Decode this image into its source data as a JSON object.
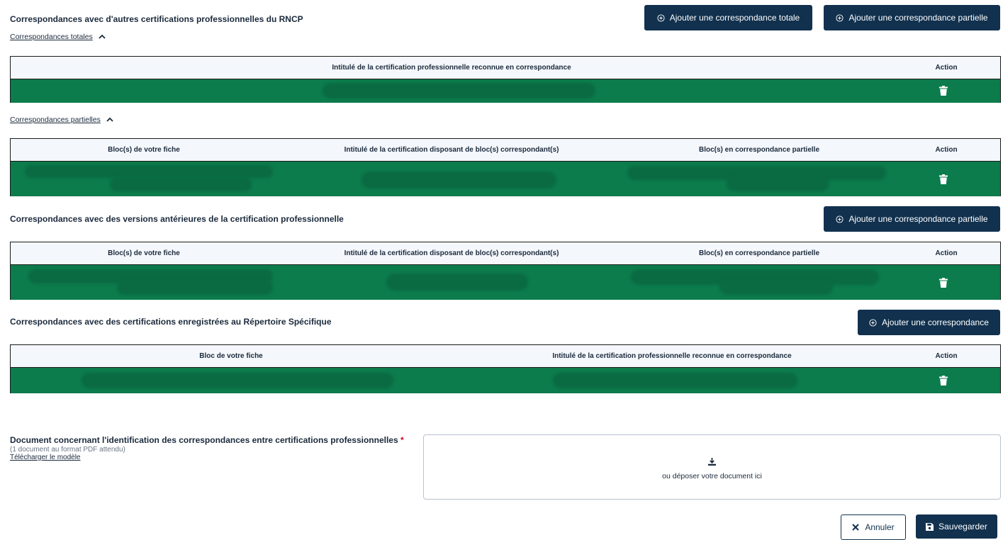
{
  "rncp": {
    "title": "Correspondances avec d'autres certifications professionnelles du RNCP",
    "btn_totale": "Ajouter une correspondance totale",
    "btn_partielle": "Ajouter une correspondance partielle",
    "totales_link": "Correspondances totales",
    "totales_headers": [
      "Intitulé de la certification professionnelle reconnue en correspondance",
      "Action"
    ],
    "partielles_link": "Correspondances partielles",
    "partielles_headers": [
      "Bloc(s) de votre fiche",
      "Intitulé de la certification disposant de bloc(s) correspondant(s)",
      "Bloc(s) en correspondance partielle",
      "Action"
    ]
  },
  "anterieures": {
    "title": "Correspondances avec des versions antérieures de la certification professionnelle",
    "btn_partielle": "Ajouter une correspondance partielle",
    "headers": [
      "Bloc(s) de votre fiche",
      "Intitulé de la certification disposant de bloc(s) correspondant(s)",
      "Bloc(s) en correspondance partielle",
      "Action"
    ]
  },
  "rs": {
    "title": "Correspondances avec des certifications enregistrées au Répertoire Spécifique",
    "btn": "Ajouter une correspondance",
    "headers": [
      "Bloc de votre fiche",
      "Intitulé de la certification professionnelle reconnue en correspondance",
      "Action"
    ]
  },
  "document": {
    "label": "Document concernant l'identification des correspondances entre certifications professionnelles",
    "required_mark": "*",
    "hint": "(1 document au format PDF attendu)",
    "template_link": "Télécharger le modèle",
    "drop_text": "ou déposer votre document ici"
  },
  "footer": {
    "cancel": "Annuler",
    "save": "Sauvegarder"
  },
  "colors": {
    "primary": "#11314e",
    "row_green": "#0c7c4c"
  }
}
